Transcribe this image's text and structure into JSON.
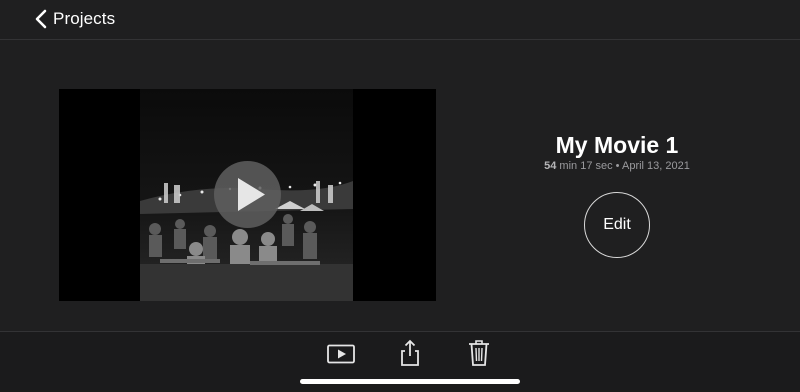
{
  "nav": {
    "back_label": "Projects",
    "back_icon": "chevron-left-icon"
  },
  "project": {
    "title": "My Movie 1",
    "duration_min": "54",
    "duration_rest": " min 17 sec",
    "separator": " • ",
    "date": "April 13, 2021"
  },
  "preview": {
    "play_icon": "play-icon"
  },
  "actions": {
    "edit_label": "Edit"
  },
  "toolbar": {
    "icons": [
      "play-preview-icon",
      "share-icon",
      "trash-icon"
    ]
  },
  "colors": {
    "background": "#1f1f20",
    "text": "#ffffff",
    "secondary_text": "#9b9b9e",
    "divider": "#333335"
  }
}
